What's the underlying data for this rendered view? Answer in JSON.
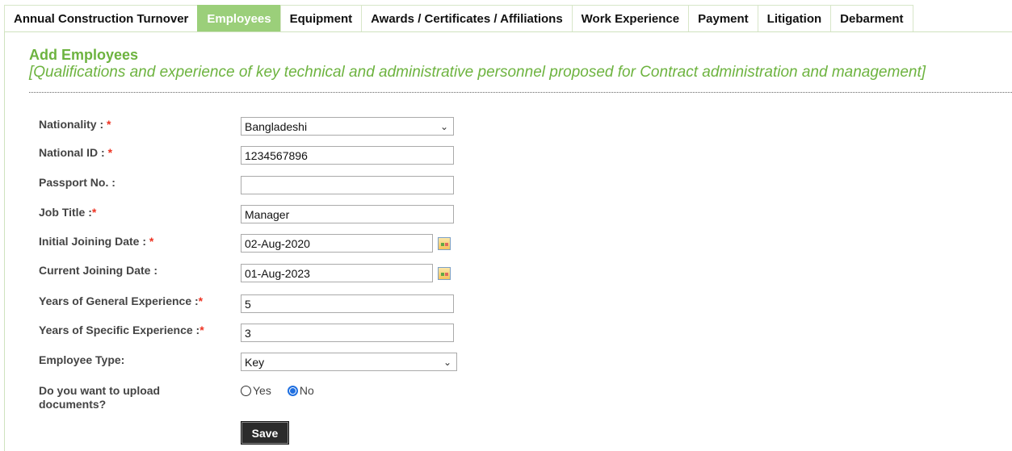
{
  "tabs": [
    {
      "label": "Annual Construction Turnover",
      "active": false
    },
    {
      "label": "Employees",
      "active": true
    },
    {
      "label": "Equipment",
      "active": false
    },
    {
      "label": "Awards / Certificates / Affiliations",
      "active": false
    },
    {
      "label": "Work Experience",
      "active": false
    },
    {
      "label": "Payment",
      "active": false
    },
    {
      "label": "Litigation",
      "active": false
    },
    {
      "label": "Debarment",
      "active": false
    }
  ],
  "header": {
    "title": "Add Employees",
    "subtitle": "[Qualifications and experience of key technical and administrative personnel proposed for Contract administration and management]"
  },
  "form": {
    "nationality": {
      "label": "Nationality : ",
      "required": "*",
      "value": "Bangladeshi"
    },
    "national_id": {
      "label": "National ID : ",
      "required": "*",
      "value": "1234567896"
    },
    "passport": {
      "label": "Passport No. :",
      "value": ""
    },
    "job_title": {
      "label": "Job Title :",
      "required": "*",
      "value": "Manager"
    },
    "initial_joining": {
      "label": "Initial Joining Date : ",
      "required": "*",
      "value": "02-Aug-2020"
    },
    "current_joining": {
      "label": "Current Joining Date :",
      "value": "01-Aug-2023"
    },
    "general_exp": {
      "label": "Years of General Experience :",
      "required": "*",
      "value": "5"
    },
    "specific_exp": {
      "label": "Years of Specific Experience :",
      "required": "*",
      "value": "3"
    },
    "employee_type": {
      "label": "Employee Type:",
      "value": "Key"
    },
    "upload_docs": {
      "label_line1": "Do you want to upload",
      "label_line2": "documents?",
      "yes": "Yes",
      "no": "No",
      "selected": "No"
    },
    "save_label": "Save"
  },
  "colors": {
    "accent": "#6db33f",
    "active_tab": "#9bcf7a",
    "required": "#e32222"
  }
}
